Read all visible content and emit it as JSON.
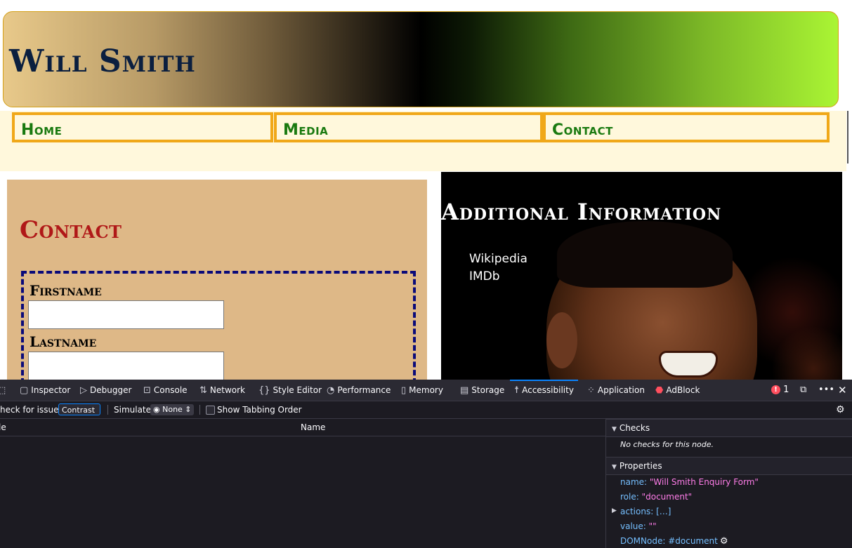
{
  "site": {
    "title": "Will Smith",
    "nav": [
      "Home",
      "Media",
      "Contact"
    ]
  },
  "contact": {
    "heading": "Contact",
    "fields": [
      {
        "label": "Firstname",
        "value": ""
      },
      {
        "label": "Lastname",
        "value": ""
      }
    ]
  },
  "info": {
    "heading": "Additional Information",
    "links": [
      "Wikipedia",
      "IMDb"
    ]
  },
  "devtools": {
    "tabs": [
      {
        "label": "Inspector",
        "icon": "inspector-icon"
      },
      {
        "label": "Debugger",
        "icon": "debugger-icon"
      },
      {
        "label": "Console",
        "icon": "console-icon"
      },
      {
        "label": "Network",
        "icon": "network-icon"
      },
      {
        "label": "Style Editor",
        "icon": "style-editor-icon"
      },
      {
        "label": "Performance",
        "icon": "performance-icon"
      },
      {
        "label": "Memory",
        "icon": "memory-icon"
      },
      {
        "label": "Storage",
        "icon": "storage-icon"
      },
      {
        "label": "Accessibility",
        "icon": "accessibility-icon",
        "active": true
      },
      {
        "label": "Application",
        "icon": "application-icon"
      },
      {
        "label": "AdBlock",
        "icon": "adblock-icon"
      }
    ],
    "error_count": "1",
    "check_label": "heck for issues:",
    "check_value": "Contrast",
    "simulate_label": "Simulate:",
    "simulate_value": "None",
    "tabbing_label": "Show Tabbing Order",
    "tree_cols": [
      "le",
      "Name"
    ],
    "checks_title": "Checks",
    "no_checks": "No checks for this node.",
    "properties_title": "Properties",
    "properties": [
      {
        "key": "name:",
        "value": "\"Will Smith Enquiry Form\"",
        "kind": "string"
      },
      {
        "key": "role:",
        "value": "\"document\"",
        "kind": "string"
      },
      {
        "key": "actions:",
        "value": "[…]",
        "kind": "bracket"
      },
      {
        "key": "value:",
        "value": "\"\"",
        "kind": "string"
      },
      {
        "key": "DOMNode:",
        "value": "#document",
        "kind": "node"
      }
    ],
    "colors": {
      "accent": "#0a84ff",
      "bg": "#1c1b22",
      "error": "#ff4f5e"
    }
  }
}
